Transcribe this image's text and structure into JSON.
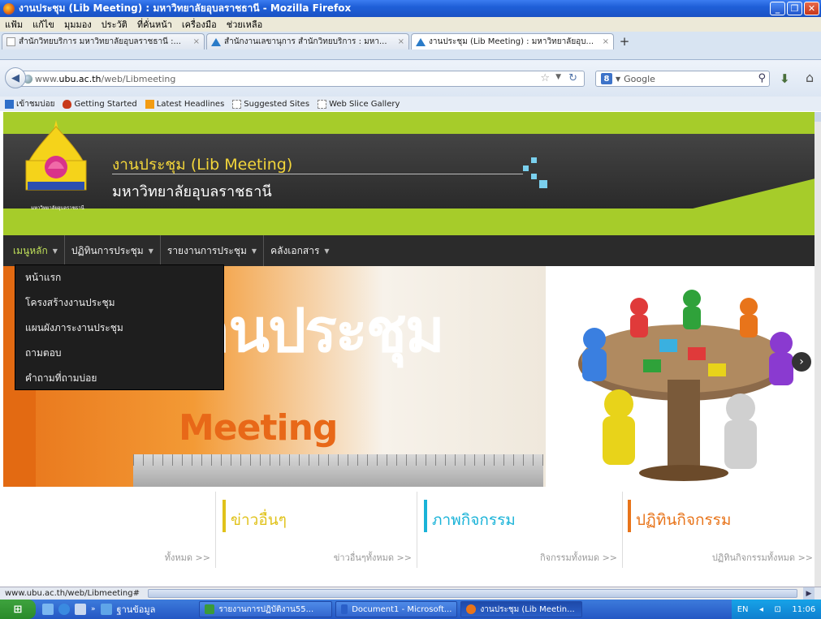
{
  "window": {
    "title": "งานประชุม (Lib Meeting) : มหาวิทยาลัยอุบลราชธานี - Mozilla Firefox"
  },
  "menubar": [
    "แฟ้ม",
    "แก้ไข",
    "มุมมอง",
    "ประวัติ",
    "ที่คั่นหน้า",
    "เครื่องมือ",
    "ช่วยเหลือ"
  ],
  "tabs": [
    {
      "label": "สำนักวิทยบริการ มหาวิทยาลัยอุบลราชธานี :..."
    },
    {
      "label": "สำนักงานเลขานุการ สำนักวิทยบริการ : มหา..."
    },
    {
      "label": "งานประชุม (Lib Meeting) : มหาวิทยาลัยอุบ..."
    }
  ],
  "address": {
    "prefix": "www.",
    "domain": "ubu.ac.th",
    "path": "/web/Libmeeting"
  },
  "search": {
    "placeholder": "Google"
  },
  "bookmarks": [
    "เข้าชมบ่อย",
    "Getting Started",
    "Latest Headlines",
    "Suggested Sites",
    "Web Slice Gallery"
  ],
  "site": {
    "title": "งานประชุม (Lib Meeting)",
    "subtitle": "มหาวิทยาลัยอุบลราชธานี",
    "logo_text": "มหาวิทยาลัยอุบลราชธานี"
  },
  "nav": [
    {
      "label": "เมนูหลัก"
    },
    {
      "label": "ปฏิทินการประชุม"
    },
    {
      "label": "รายงานการประชุม"
    },
    {
      "label": "คลังเอกสาร"
    }
  ],
  "dropdown": [
    "หน้าแรก",
    "โครงสร้างงานประชุม",
    "แผนผังภาระงานประชุม",
    "ถามตอบ",
    "คำถามที่ถามบ่อย"
  ],
  "hero": {
    "big_text": "านประชุม",
    "meeting_text": "Meeting"
  },
  "sections": [
    {
      "title": "",
      "link": "ทั้งหมด >>"
    },
    {
      "title": "ข่าวอื่นๆ",
      "link": "ข่าวอื่นๆทั้งหมด >>",
      "color": "#e0c21a"
    },
    {
      "title": "ภาพกิจกรรม",
      "link": "กิจกรรมทั้งหมด >>",
      "color": "#1ab3d8"
    },
    {
      "title": "ปฏิทินกิจกรรม",
      "link": "ปฏิทินกิจกรรมทั้งหมด >>",
      "color": "#e8741a"
    }
  ],
  "status": {
    "url": "www.ubu.ac.th/web/Libmeeting#"
  },
  "taskbar": {
    "quick": "ฐานข้อมูล",
    "tasks": [
      {
        "label": "รายงานการปฏิบัติงาน55..."
      },
      {
        "label": "Document1 - Microsoft..."
      },
      {
        "label": "งานประชุม (Lib Meetin..."
      }
    ],
    "lang": "EN",
    "time": "11:06"
  }
}
